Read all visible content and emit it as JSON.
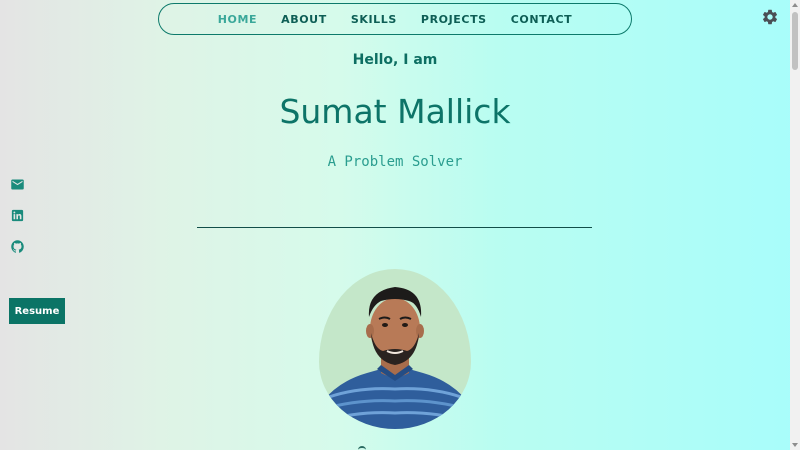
{
  "nav": {
    "items": [
      {
        "label": "HOME",
        "active": true
      },
      {
        "label": "ABOUT"
      },
      {
        "label": "SKILLS"
      },
      {
        "label": "PROJECTS"
      },
      {
        "label": "CONTACT"
      }
    ]
  },
  "hero": {
    "greeting": "Hello, I am",
    "name": "Sumat Mallick",
    "tagline": "A Problem Solver"
  },
  "sidebar": {
    "resume_label": "Resume",
    "icons": [
      "email-icon",
      "linkedin-icon",
      "github-icon"
    ]
  },
  "colors": {
    "primary": "#0b7466",
    "nav_active": "#3aa89a",
    "photo_bg": "#c4e7c9"
  },
  "settings_icon": "gear-icon"
}
